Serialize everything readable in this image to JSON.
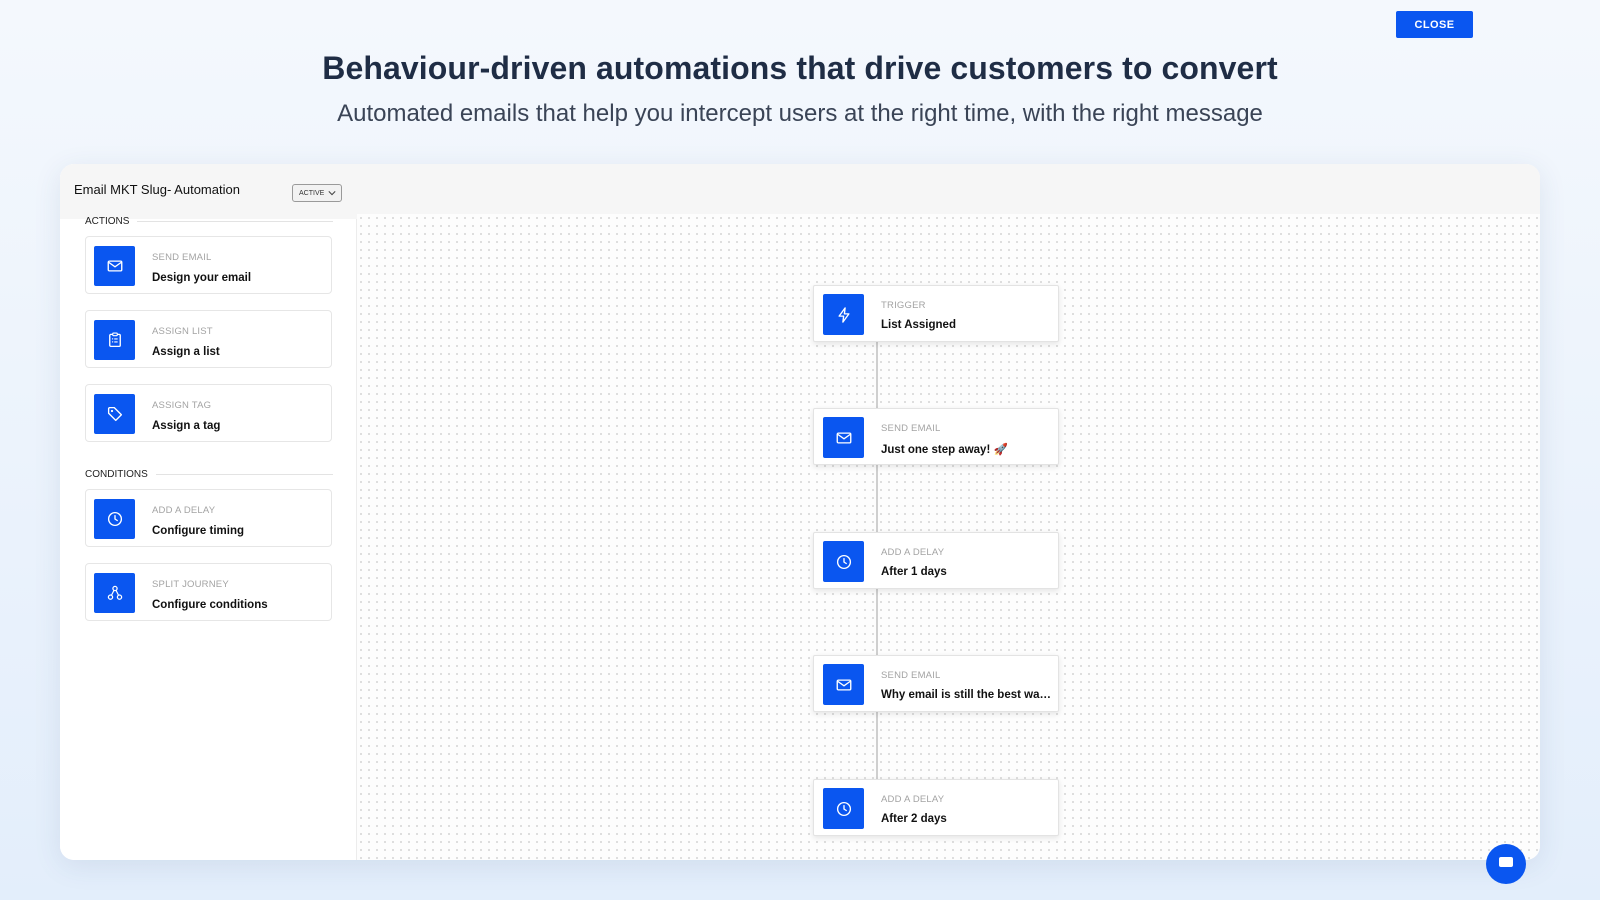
{
  "hero": {
    "title": "Behaviour-driven automations that drive customers to convert",
    "subtitle": "Automated emails that help you intercept users at the right time, with the right message"
  },
  "sidebar": {
    "title": "Email MKT Slug- Automation",
    "status": "ACTIVE",
    "actions_label": "ACTIONS",
    "conditions_label": "CONDITIONS",
    "actions": [
      {
        "category": "SEND EMAIL",
        "label": "Design your email",
        "icon": "mail-icon"
      },
      {
        "category": "ASSIGN LIST",
        "label": "Assign a list",
        "icon": "clipboard-icon"
      },
      {
        "category": "ASSIGN TAG",
        "label": "Assign a tag",
        "icon": "tag-icon"
      }
    ],
    "conditions": [
      {
        "category": "ADD A DELAY",
        "label": "Configure timing",
        "icon": "clock-icon"
      },
      {
        "category": "SPLIT JOURNEY",
        "label": "Configure conditions",
        "icon": "split-icon"
      }
    ]
  },
  "header": {
    "close_label": "CLOSE"
  },
  "flow": [
    {
      "category": "TRIGGER",
      "label": "List Assigned",
      "icon": "lightning-icon"
    },
    {
      "category": "SEND EMAIL",
      "label": "Just one step away! 🚀",
      "icon": "mail-icon"
    },
    {
      "category": "ADD A DELAY",
      "label": "After 1 days",
      "icon": "clock-icon"
    },
    {
      "category": "SEND EMAIL",
      "label": "Why email is still the best way to reach your customers",
      "icon": "mail-icon"
    },
    {
      "category": "ADD A DELAY",
      "label": "After 2 days",
      "icon": "clock-icon"
    }
  ],
  "colors": {
    "accent": "#0a56f0",
    "heading": "#1f2d45"
  }
}
